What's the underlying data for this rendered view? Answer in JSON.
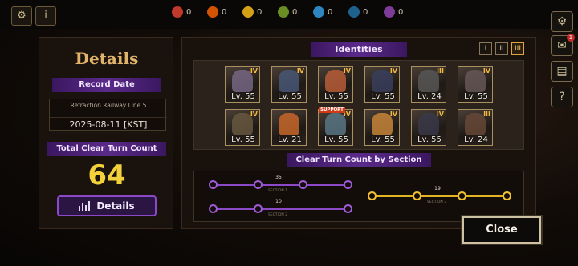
{
  "resources": [
    {
      "name": "wrath-resource",
      "count": "0",
      "color": "#c0392b"
    },
    {
      "name": "lust-resource",
      "count": "0",
      "color": "#d35400"
    },
    {
      "name": "sloth-resource",
      "count": "0",
      "color": "#d4a017"
    },
    {
      "name": "gluttony-resource",
      "count": "0",
      "color": "#6b8e23"
    },
    {
      "name": "gloom-resource",
      "count": "0",
      "color": "#2e86c1"
    },
    {
      "name": "pride-resource",
      "count": "0",
      "color": "#1f618d"
    },
    {
      "name": "envy-resource",
      "count": "0",
      "color": "#7d3c98"
    }
  ],
  "left": {
    "title": "Details",
    "record_date_label": "Record Date",
    "location": "Refraction Railway Line 5",
    "date": "2025-08-11 [KST]",
    "total_label": "Total Clear Turn Count",
    "total_value": "64",
    "details_button": "Details"
  },
  "main": {
    "identities_title": "Identities",
    "tabs": [
      "I",
      "II",
      "III"
    ],
    "active_tab": "III",
    "section_title": "Clear Turn Count by Section",
    "close_button": "Close"
  },
  "identities": [
    {
      "rank": "IV",
      "level": "Lv. 55",
      "color": "#7a6a8a",
      "support": ""
    },
    {
      "rank": "IV",
      "level": "Lv. 55",
      "color": "#4a5a7a",
      "support": ""
    },
    {
      "rank": "IV",
      "level": "Lv. 55",
      "color": "#c0603a",
      "support": ""
    },
    {
      "rank": "IV",
      "level": "Lv. 55",
      "color": "#3a4060",
      "support": ""
    },
    {
      "rank": "III",
      "level": "Lv. 24",
      "color": "#5a5a5a",
      "support": ""
    },
    {
      "rank": "IV",
      "level": "Lv. 55",
      "color": "#6a5a5a",
      "support": ""
    },
    {
      "rank": "IV",
      "level": "Lv. 55",
      "color": "#6a5a40",
      "support": ""
    },
    {
      "rank": "",
      "level": "Lv. 21",
      "color": "#d06a2a",
      "support": ""
    },
    {
      "rank": "IV",
      "level": "Lv. 55",
      "color": "#5a7a8a",
      "support": "SUPPORT"
    },
    {
      "rank": "IV",
      "level": "Lv. 55",
      "color": "#d08a3a",
      "support": ""
    },
    {
      "rank": "IV",
      "level": "Lv. 55",
      "color": "#3a3a4a",
      "support": ""
    },
    {
      "rank": "III",
      "level": "Lv. 24",
      "color": "#6a4a3a",
      "support": ""
    }
  ],
  "sections": [
    {
      "count": "35",
      "label": "SECTION 1"
    },
    {
      "count": "10",
      "label": "SECTION 2"
    },
    {
      "count": "19",
      "label": "SECTION 3"
    }
  ],
  "colors": {
    "accent_purple": "#8b49c7",
    "accent_gold": "#f3d13b",
    "track_gold": "#e2b325"
  }
}
